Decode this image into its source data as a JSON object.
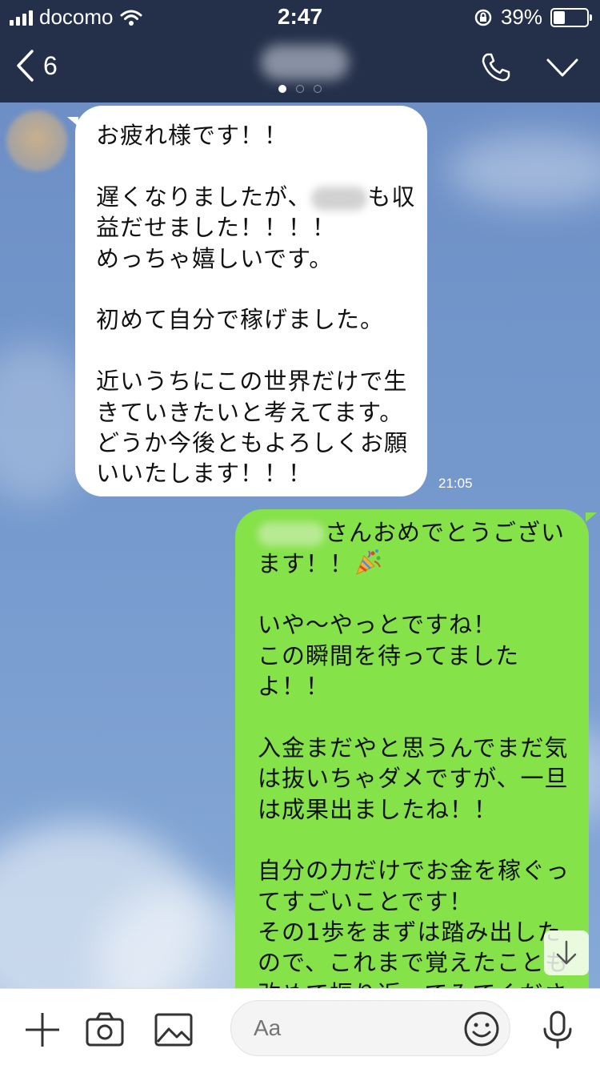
{
  "status_bar": {
    "carrier": "docomo",
    "time": "2:47",
    "battery": "39%",
    "battery_level": 0.39
  },
  "header": {
    "back_count": "6",
    "icons": [
      "back-chevron-icon",
      "phone-icon",
      "chevron-down-icon"
    ],
    "page_dots": 3,
    "active_dot": 0
  },
  "messages": {
    "received": {
      "lines": [
        "お疲れ様です！！",
        "",
        "遅くなりましたが、[blur]も収",
        "益だせました！！！！",
        "めっちゃ嬉しいです。",
        "",
        "初めて自分で稼げました。",
        "",
        "近いうちにこの世界だけで生",
        "きていきたいと考えてます。",
        "どうか今後ともよろしくお願",
        "いいたします！！！"
      ],
      "line_2_before": "遅くなりましたが、",
      "line_2_after": "も収",
      "time": "21:05"
    },
    "sent": {
      "line_0_after": "さんおめでとうござい",
      "line_1": "ます！！",
      "lines": [
        "",
        "いや〜やっとですね！",
        "この瞬間を待ってました",
        "よ！！",
        "",
        "入金まだやと思うんでまだ気",
        "は抜いちゃダメですが、一旦",
        "は成果出ましたね！！",
        "",
        "自分の力だけでお金を稼ぐっ",
        "てすごいことです！",
        "その1歩をまずは踏み出した",
        "ので、これまで覚えたことも",
        "改めて振り返ってみてくださ"
      ]
    }
  },
  "input_bar": {
    "placeholder": "Aa",
    "icons": [
      "plus-icon",
      "camera-icon",
      "image-icon",
      "smile-icon",
      "microphone-icon"
    ]
  },
  "colors": {
    "header_bg": "#243049",
    "chat_bg": "#7599cd",
    "sent_bubble": "#85e249",
    "received_bubble": "#ffffff"
  }
}
